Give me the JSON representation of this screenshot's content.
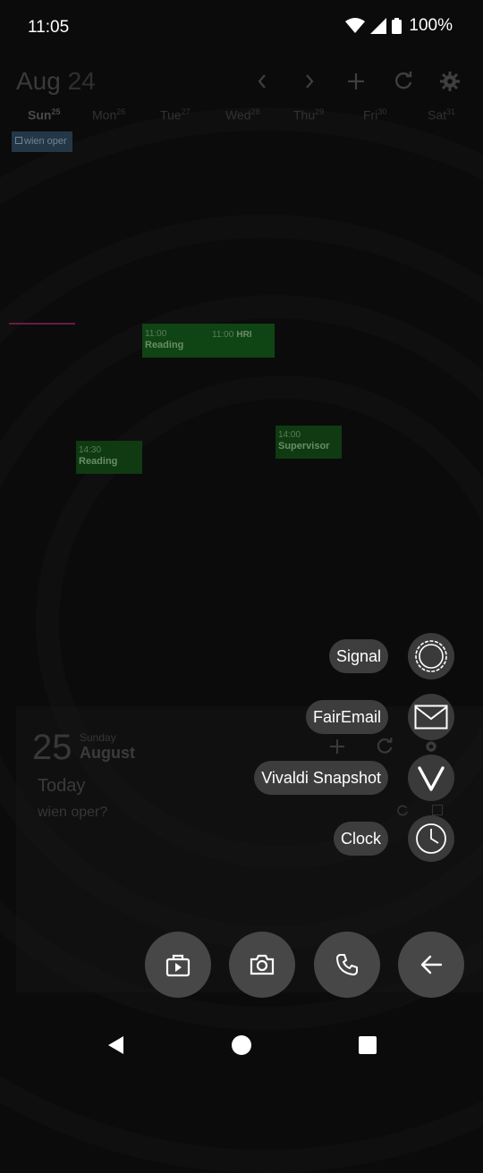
{
  "status": {
    "time": "11:05",
    "battery": "100%"
  },
  "calendar": {
    "month": "Aug",
    "day": "24",
    "weekdays": [
      {
        "label": "Sun",
        "num": "25"
      },
      {
        "label": "Mon",
        "num": "26"
      },
      {
        "label": "Tue",
        "num": "27"
      },
      {
        "label": "Wed",
        "num": "28"
      },
      {
        "label": "Thu",
        "num": "29"
      },
      {
        "label": "Fri",
        "num": "30"
      },
      {
        "label": "Sat",
        "num": "31"
      }
    ],
    "allday_event": "wien oper",
    "events": [
      {
        "time": "11:00",
        "name": "Reading"
      },
      {
        "time": "11:00",
        "name": "HRI"
      },
      {
        "time": "14:30",
        "name": "Reading"
      },
      {
        "time": "14:00",
        "name": "Supervisor"
      }
    ]
  },
  "agenda_widget": {
    "day_number": "25",
    "day_of_week": "Sunday",
    "month": "August",
    "today_label": "Today",
    "today_event": "wien oper?"
  },
  "shortcuts": [
    {
      "label": "Signal",
      "icon": "signal-icon"
    },
    {
      "label": "FairEmail",
      "icon": "mail-icon"
    },
    {
      "label": "Vivaldi Snapshot",
      "icon": "vivaldi-icon"
    },
    {
      "label": "Clock",
      "icon": "clock-icon"
    }
  ],
  "dock": [
    "play-store-icon",
    "camera-icon",
    "phone-icon",
    "back-arrow-icon"
  ],
  "colors": {
    "event_green": "#0f4414",
    "event_green_light": "#0f3a12",
    "allday_blue": "#243746",
    "now_line": "#6a1b44",
    "pill_bg": "#3d3d3d"
  }
}
